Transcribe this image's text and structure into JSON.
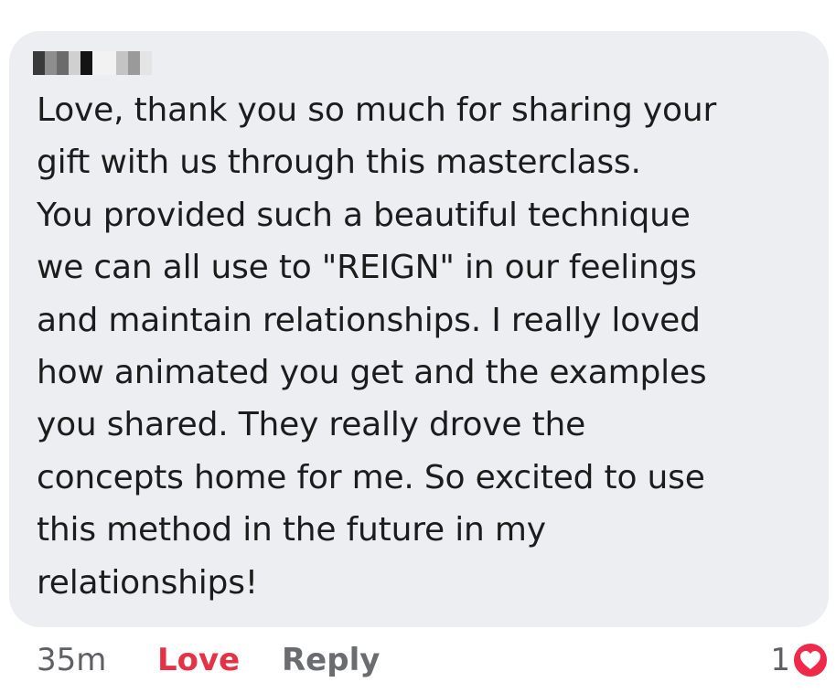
{
  "comment": {
    "author_redacted": true,
    "body": "Love, thank you so much for sharing your\ngift with us through this masterclass.\nYou provided such a beautiful technique\nwe can all use to \"REIGN\" in our feelings\nand maintain relationships. I really loved\nhow animated you get and the examples\nyou shared. They really drove the\nconcepts home for me. So excited to use\nthis method in the future in my\nrelationships!",
    "background_color": "#edeef2"
  },
  "actions": {
    "time": "35m",
    "love_label": "Love",
    "love_color": "#e73245",
    "reply_label": "Reply"
  },
  "reaction": {
    "count": "1",
    "icon": "heart-icon",
    "color": "#f02849"
  }
}
